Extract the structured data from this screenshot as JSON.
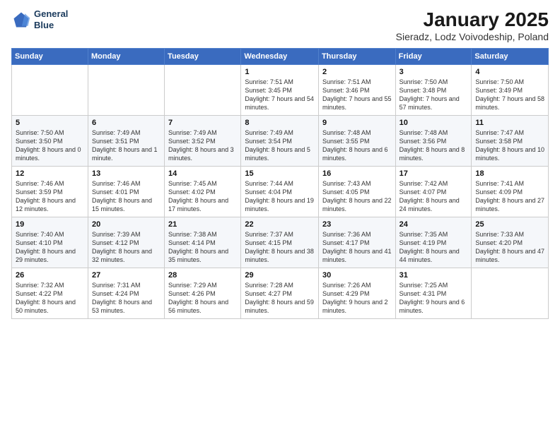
{
  "logo": {
    "line1": "General",
    "line2": "Blue"
  },
  "title": "January 2025",
  "subtitle": "Sieradz, Lodz Voivodeship, Poland",
  "days_of_week": [
    "Sunday",
    "Monday",
    "Tuesday",
    "Wednesday",
    "Thursday",
    "Friday",
    "Saturday"
  ],
  "weeks": [
    [
      {
        "day": "",
        "info": ""
      },
      {
        "day": "",
        "info": ""
      },
      {
        "day": "",
        "info": ""
      },
      {
        "day": "1",
        "info": "Sunrise: 7:51 AM\nSunset: 3:45 PM\nDaylight: 7 hours and 54 minutes."
      },
      {
        "day": "2",
        "info": "Sunrise: 7:51 AM\nSunset: 3:46 PM\nDaylight: 7 hours and 55 minutes."
      },
      {
        "day": "3",
        "info": "Sunrise: 7:50 AM\nSunset: 3:48 PM\nDaylight: 7 hours and 57 minutes."
      },
      {
        "day": "4",
        "info": "Sunrise: 7:50 AM\nSunset: 3:49 PM\nDaylight: 7 hours and 58 minutes."
      }
    ],
    [
      {
        "day": "5",
        "info": "Sunrise: 7:50 AM\nSunset: 3:50 PM\nDaylight: 8 hours and 0 minutes."
      },
      {
        "day": "6",
        "info": "Sunrise: 7:49 AM\nSunset: 3:51 PM\nDaylight: 8 hours and 1 minute."
      },
      {
        "day": "7",
        "info": "Sunrise: 7:49 AM\nSunset: 3:52 PM\nDaylight: 8 hours and 3 minutes."
      },
      {
        "day": "8",
        "info": "Sunrise: 7:49 AM\nSunset: 3:54 PM\nDaylight: 8 hours and 5 minutes."
      },
      {
        "day": "9",
        "info": "Sunrise: 7:48 AM\nSunset: 3:55 PM\nDaylight: 8 hours and 6 minutes."
      },
      {
        "day": "10",
        "info": "Sunrise: 7:48 AM\nSunset: 3:56 PM\nDaylight: 8 hours and 8 minutes."
      },
      {
        "day": "11",
        "info": "Sunrise: 7:47 AM\nSunset: 3:58 PM\nDaylight: 8 hours and 10 minutes."
      }
    ],
    [
      {
        "day": "12",
        "info": "Sunrise: 7:46 AM\nSunset: 3:59 PM\nDaylight: 8 hours and 12 minutes."
      },
      {
        "day": "13",
        "info": "Sunrise: 7:46 AM\nSunset: 4:01 PM\nDaylight: 8 hours and 15 minutes."
      },
      {
        "day": "14",
        "info": "Sunrise: 7:45 AM\nSunset: 4:02 PM\nDaylight: 8 hours and 17 minutes."
      },
      {
        "day": "15",
        "info": "Sunrise: 7:44 AM\nSunset: 4:04 PM\nDaylight: 8 hours and 19 minutes."
      },
      {
        "day": "16",
        "info": "Sunrise: 7:43 AM\nSunset: 4:05 PM\nDaylight: 8 hours and 22 minutes."
      },
      {
        "day": "17",
        "info": "Sunrise: 7:42 AM\nSunset: 4:07 PM\nDaylight: 8 hours and 24 minutes."
      },
      {
        "day": "18",
        "info": "Sunrise: 7:41 AM\nSunset: 4:09 PM\nDaylight: 8 hours and 27 minutes."
      }
    ],
    [
      {
        "day": "19",
        "info": "Sunrise: 7:40 AM\nSunset: 4:10 PM\nDaylight: 8 hours and 29 minutes."
      },
      {
        "day": "20",
        "info": "Sunrise: 7:39 AM\nSunset: 4:12 PM\nDaylight: 8 hours and 32 minutes."
      },
      {
        "day": "21",
        "info": "Sunrise: 7:38 AM\nSunset: 4:14 PM\nDaylight: 8 hours and 35 minutes."
      },
      {
        "day": "22",
        "info": "Sunrise: 7:37 AM\nSunset: 4:15 PM\nDaylight: 8 hours and 38 minutes."
      },
      {
        "day": "23",
        "info": "Sunrise: 7:36 AM\nSunset: 4:17 PM\nDaylight: 8 hours and 41 minutes."
      },
      {
        "day": "24",
        "info": "Sunrise: 7:35 AM\nSunset: 4:19 PM\nDaylight: 8 hours and 44 minutes."
      },
      {
        "day": "25",
        "info": "Sunrise: 7:33 AM\nSunset: 4:20 PM\nDaylight: 8 hours and 47 minutes."
      }
    ],
    [
      {
        "day": "26",
        "info": "Sunrise: 7:32 AM\nSunset: 4:22 PM\nDaylight: 8 hours and 50 minutes."
      },
      {
        "day": "27",
        "info": "Sunrise: 7:31 AM\nSunset: 4:24 PM\nDaylight: 8 hours and 53 minutes."
      },
      {
        "day": "28",
        "info": "Sunrise: 7:29 AM\nSunset: 4:26 PM\nDaylight: 8 hours and 56 minutes."
      },
      {
        "day": "29",
        "info": "Sunrise: 7:28 AM\nSunset: 4:27 PM\nDaylight: 8 hours and 59 minutes."
      },
      {
        "day": "30",
        "info": "Sunrise: 7:26 AM\nSunset: 4:29 PM\nDaylight: 9 hours and 2 minutes."
      },
      {
        "day": "31",
        "info": "Sunrise: 7:25 AM\nSunset: 4:31 PM\nDaylight: 9 hours and 6 minutes."
      },
      {
        "day": "",
        "info": ""
      }
    ]
  ]
}
